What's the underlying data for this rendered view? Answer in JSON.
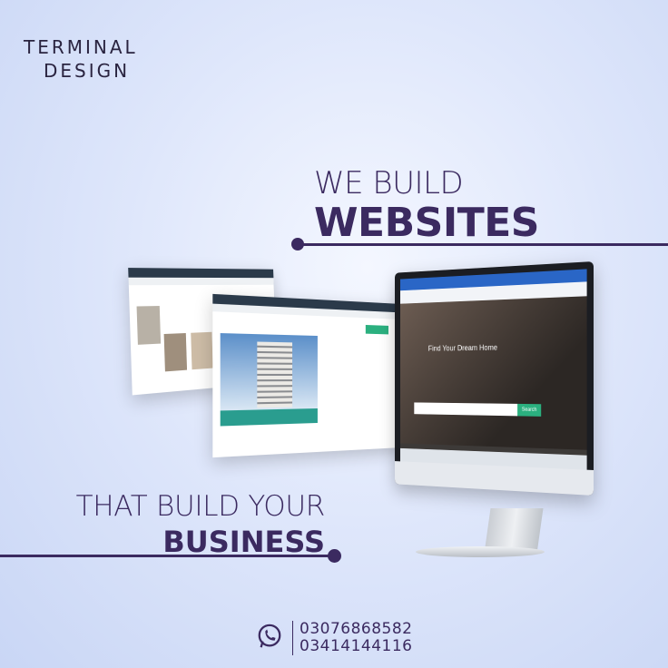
{
  "brand": {
    "line1": "TERMINAL",
    "line2": "DESIGN"
  },
  "headline_top": {
    "light": "WE BUILD",
    "bold": "WEBSITES"
  },
  "headline_bottom": {
    "light": "THAT BUILD YOUR",
    "bold": "BUSINESS"
  },
  "monitor": {
    "hero_text": "Find Your Dream Home",
    "search_button": "Search"
  },
  "contact": {
    "icon": "whatsapp-icon",
    "phones": [
      "03076868582",
      "03414144116"
    ]
  },
  "colors": {
    "primary": "#3b2a60",
    "background": "#dfe7fb",
    "accent": "#2bb07f"
  }
}
